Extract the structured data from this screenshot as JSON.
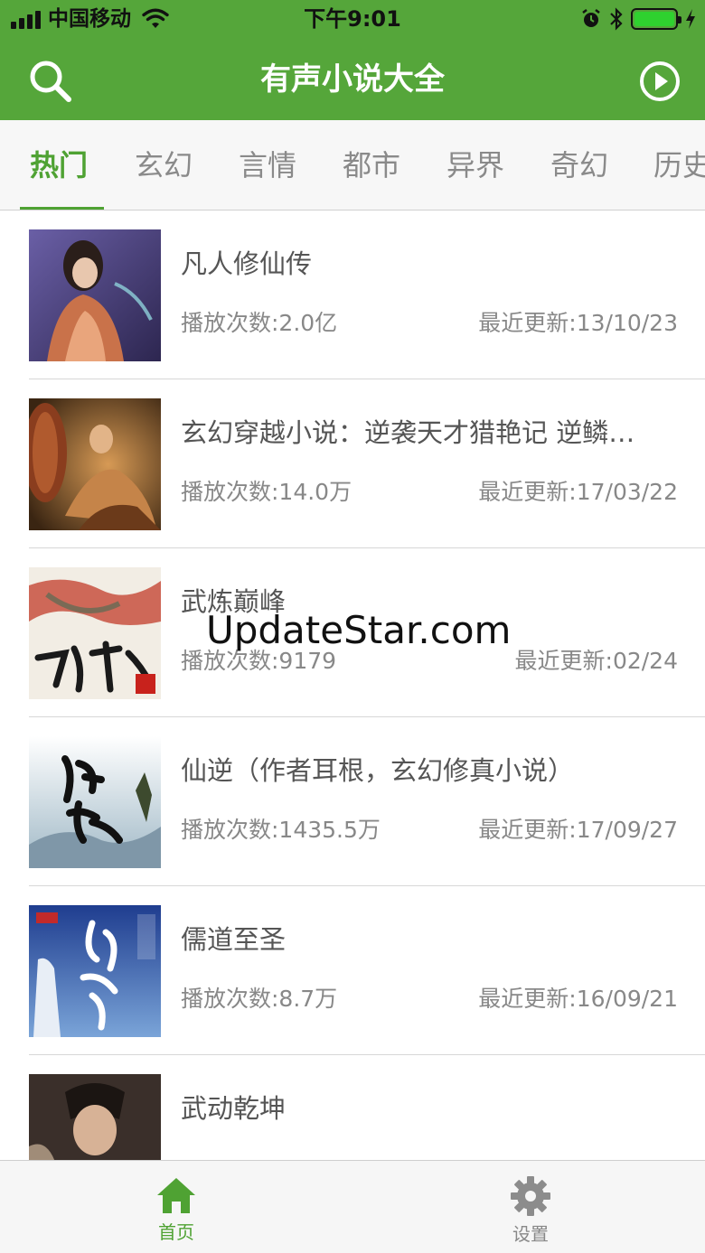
{
  "status_bar": {
    "carrier": "中国移动",
    "time": "下午9:01"
  },
  "nav": {
    "title": "有声小说大全",
    "search_icon": "search-icon",
    "play_icon": "play-circle-icon"
  },
  "tabs": [
    {
      "label": "热门",
      "active": true
    },
    {
      "label": "玄幻",
      "active": false
    },
    {
      "label": "言情",
      "active": false
    },
    {
      "label": "都市",
      "active": false
    },
    {
      "label": "异界",
      "active": false
    },
    {
      "label": "奇幻",
      "active": false
    },
    {
      "label": "历史",
      "active": false
    }
  ],
  "novels": [
    {
      "title": "凡人修仙传",
      "plays": "播放次数:2.0亿",
      "updated": "最近更新:13/10/23"
    },
    {
      "title": "玄幻穿越小说：逆袭天才猎艳记 逆鳞…",
      "plays": "播放次数:14.0万",
      "updated": "最近更新:17/03/22"
    },
    {
      "title": "武炼巅峰",
      "plays": "播放次数:9179",
      "updated": "最近更新:02/24"
    },
    {
      "title": "仙逆（作者耳根，玄幻修真小说）",
      "plays": "播放次数:1435.5万",
      "updated": "最近更新:17/09/27"
    },
    {
      "title": "儒道至圣",
      "plays": "播放次数:8.7万",
      "updated": "最近更新:16/09/21"
    },
    {
      "title": "武动乾坤",
      "plays": "",
      "updated": ""
    }
  ],
  "watermark": "UpdateStar.com",
  "tabbar": {
    "home_label": "首页",
    "settings_label": "设置"
  },
  "colors": {
    "brand_green": "#55a63a",
    "active_tab": "#4fa233"
  }
}
